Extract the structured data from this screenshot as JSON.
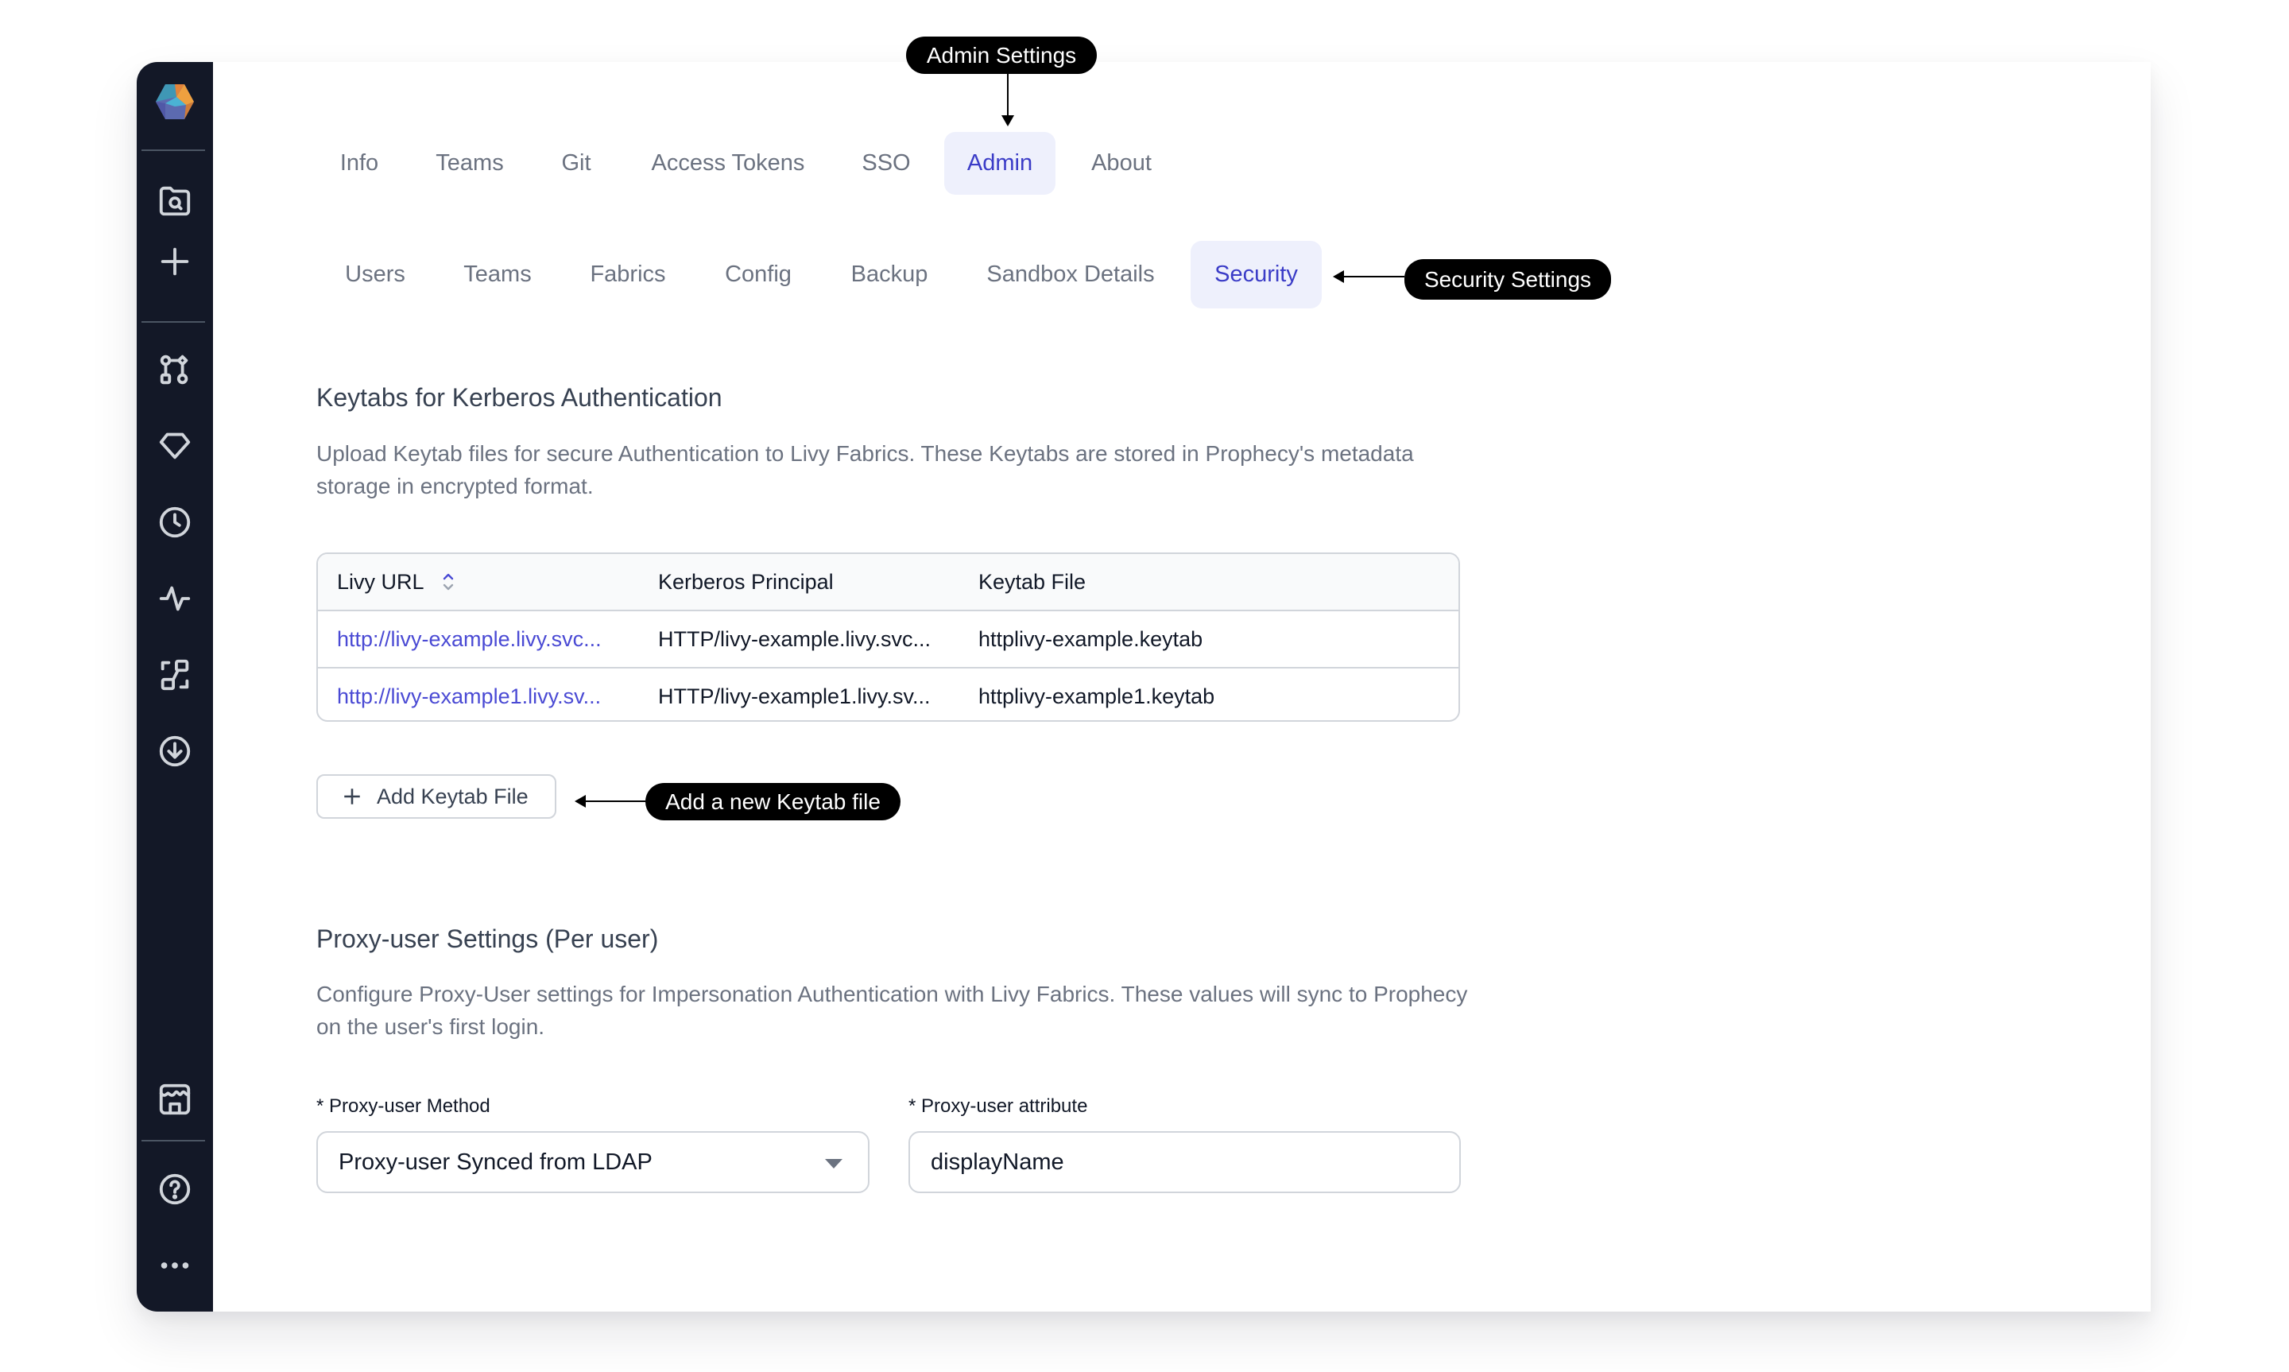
{
  "sidebar": {
    "logo": "prophecy-hexagon-logo",
    "items": [
      {
        "name": "folder-search-icon",
        "label": "Browse"
      },
      {
        "name": "plus-icon",
        "label": "Create"
      },
      {
        "name": "pipeline-icon",
        "label": "Pipelines"
      },
      {
        "name": "gem-icon",
        "label": "Gems"
      },
      {
        "name": "clock-icon",
        "label": "History"
      },
      {
        "name": "activity-icon",
        "label": "Observability"
      },
      {
        "name": "lineage-icon",
        "label": "Lineage"
      },
      {
        "name": "download-icon",
        "label": "Deployments"
      },
      {
        "name": "marketplace-icon",
        "label": "Marketplace"
      },
      {
        "name": "help-icon",
        "label": "Help"
      },
      {
        "name": "more-icon",
        "label": "More"
      }
    ]
  },
  "main_tabs": [
    {
      "label": "Info",
      "active": false
    },
    {
      "label": "Teams",
      "active": false
    },
    {
      "label": "Git",
      "active": false
    },
    {
      "label": "Access Tokens",
      "active": false
    },
    {
      "label": "SSO",
      "active": false
    },
    {
      "label": "Admin",
      "active": true
    },
    {
      "label": "About",
      "active": false
    }
  ],
  "sub_tabs": [
    {
      "label": "Users",
      "active": false
    },
    {
      "label": "Teams",
      "active": false
    },
    {
      "label": "Fabrics",
      "active": false
    },
    {
      "label": "Config",
      "active": false
    },
    {
      "label": "Backup",
      "active": false
    },
    {
      "label": "Sandbox Details",
      "active": false
    },
    {
      "label": "Security",
      "active": true
    }
  ],
  "keytabs": {
    "title": "Keytabs for Kerberos Authentication",
    "description": "Upload Keytab files for secure Authentication to Livy Fabrics. These Keytabs are stored in Prophecy's metadata storage in encrypted format.",
    "columns": [
      "Livy URL",
      "Kerberos Principal",
      "Keytab File"
    ],
    "sort": {
      "column": "Livy URL",
      "direction": "ascending"
    },
    "rows": [
      {
        "livy_url": "http://livy-example.livy.svc...",
        "principal": "HTTP/livy-example.livy.svc...",
        "keytab_file": "httplivy-example.keytab"
      },
      {
        "livy_url": "http://livy-example1.livy.sv...",
        "principal": "HTTP/livy-example1.livy.sv...",
        "keytab_file": "httplivy-example1.keytab"
      }
    ],
    "add_button": "Add Keytab File"
  },
  "proxy": {
    "title": "Proxy-user Settings (Per user)",
    "description": "Configure Proxy-User settings for Impersonation Authentication with Livy Fabrics. These values will sync to Prophecy on the user's first login.",
    "method_label": "* Proxy-user Method",
    "method_value": "Proxy-user Synced from LDAP",
    "attribute_label": "* Proxy-user attribute",
    "attribute_value": "displayName"
  },
  "annotations": {
    "admin": "Admin Settings",
    "security": "Security Settings",
    "add_keytab": "Add a new Keytab file"
  },
  "colors": {
    "sidebar_bg": "#131827",
    "accent": "#3b3cc7",
    "active_tab_bg": "#eef0fc",
    "link": "#4a4ad4"
  }
}
